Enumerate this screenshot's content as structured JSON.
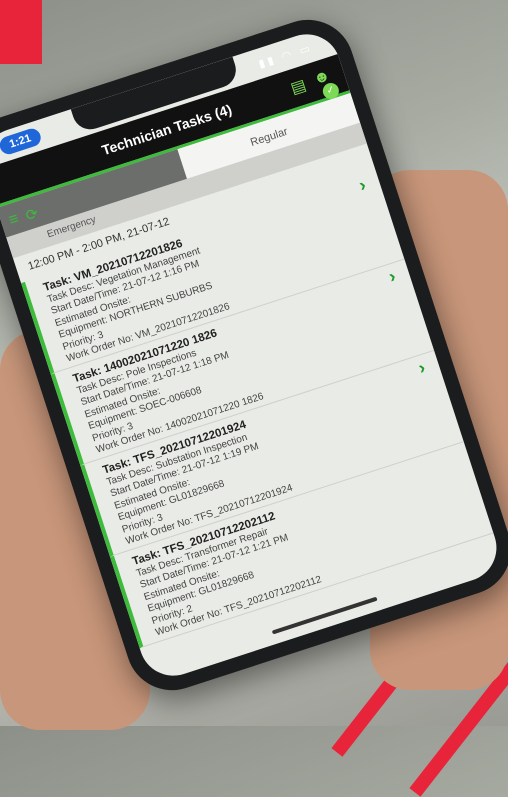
{
  "status": {
    "time": "1:21"
  },
  "app": {
    "title": "Technician Tasks (4)"
  },
  "tabs": {
    "emergency": "Emergency",
    "regular": "Regular"
  },
  "range": "12:00 PM - 2:00 PM, 21-07-12",
  "tasks": [
    {
      "title": "Task: VM_20210712201826",
      "lines": [
        "Task Desc: Vegetation Management",
        "Start Date/Time: 21-07-12 1:16 PM",
        "Estimated Onsite:",
        "Equipment: NORTHERN SUBURBS",
        "Priority: 3",
        "Work Order No: VM_20210712201826"
      ]
    },
    {
      "title": "Task: 14002021071220 1826",
      "lines": [
        "Task Desc: Pole Inspections",
        "Start Date/Time: 21-07-12 1:18 PM",
        "Estimated Onsite:",
        "Equipment: SOEC-006608",
        "Priority: 3",
        "Work Order No: 14002021071220 1826"
      ]
    },
    {
      "title": "Task: TFS_20210712201924",
      "lines": [
        "Task Desc: Substation Inspection",
        "Start Date/Time: 21-07-12 1:19 PM",
        "Estimated Onsite:",
        "Equipment: GL01829668",
        "Priority: 3",
        "Work Order No: TFS_20210712201924"
      ]
    },
    {
      "title": "Task: TFS_20210712202112",
      "lines": [
        "Task Desc: Transformer Repair",
        "Start Date/Time: 21-07-12 1:21 PM",
        "Estimated Onsite:",
        "Equipment: GL01829668",
        "Priority: 2",
        "Work Order No: TFS_20210712202112"
      ]
    }
  ],
  "colors": {
    "accent_red": "#e8243b",
    "app_green": "#3dbb3a"
  }
}
